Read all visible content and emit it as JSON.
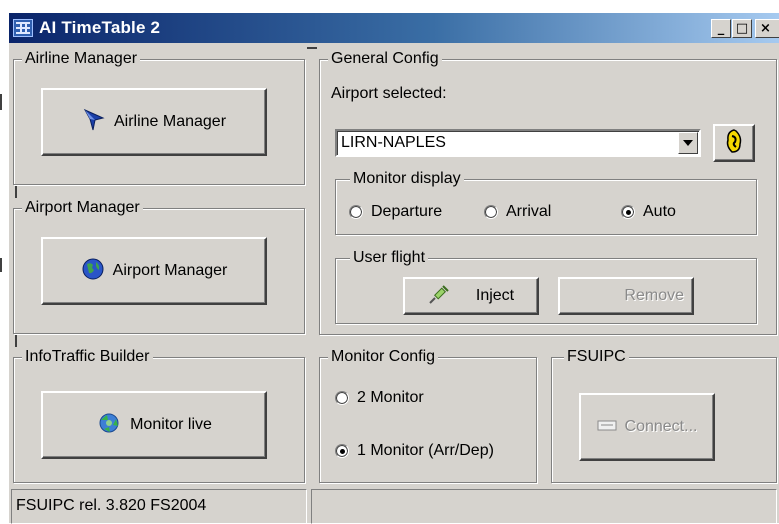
{
  "window": {
    "title": "AI TimeTable 2",
    "controls": {
      "minimize": "_",
      "maximize": "□",
      "close": "×"
    }
  },
  "airline_manager": {
    "group_label": "Airline Manager",
    "button_label": "Airline Manager",
    "icon": "airplane-icon"
  },
  "airport_manager": {
    "group_label": "Airport Manager",
    "button_label": "Airport Manager",
    "icon": "globe-icon"
  },
  "infotraffic_builder": {
    "group_label": "InfoTraffic Builder",
    "button_label": "Monitor live",
    "icon": "recycle-globe-icon"
  },
  "general_config": {
    "group_label": "General Config",
    "airport_label": "Airport selected:",
    "airport_value": "LIRN-NAPLES",
    "refresh_icon": "yellow-refresh-icon",
    "monitor_display": {
      "group_label": "Monitor display",
      "options": [
        "Departure",
        "Arrival",
        "Auto"
      ],
      "selected": "Auto"
    },
    "user_flight": {
      "group_label": "User flight",
      "inject_label": "Inject",
      "remove_label": "Remove",
      "inject_icon": "syringe-icon"
    }
  },
  "monitor_config": {
    "group_label": "Monitor Config",
    "options": [
      "2 Monitor",
      "1 Monitor (Arr/Dep)"
    ],
    "selected": "1 Monitor (Arr/Dep)"
  },
  "fsuipc": {
    "group_label": "FSUIPC",
    "connect_label": "Connect...",
    "connect_icon": "connect-icon"
  },
  "status_bar": {
    "left": "FSUIPC rel. 3.820 FS2004",
    "right": ""
  },
  "colors": {
    "face": "#d6d3ce",
    "title_start": "#0a246a",
    "title_end": "#a6caf0",
    "disabled_text": "#8a8a8a"
  }
}
